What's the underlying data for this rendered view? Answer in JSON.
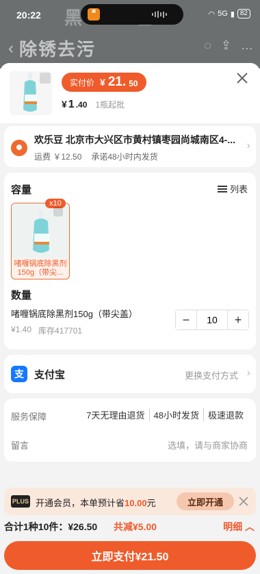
{
  "status_bar": {
    "time": "20:22",
    "battery": "82",
    "network": "5G"
  },
  "background": {
    "title": "黑",
    "title2": "喔",
    "nav_title": "除锈去污"
  },
  "product": {
    "price_tag": "实付价",
    "price_currency": "¥",
    "price_int": "21.",
    "price_dec": "50",
    "unit_currency": "¥",
    "unit_int": "1",
    "unit_dec": ".40",
    "moq": "1瓶起批"
  },
  "address": {
    "text": "欢乐豆 北京市大兴区市黄村镇枣园尚城南区4-...",
    "shipping": "运费 ￥12.50",
    "promise": "承诺48小时内发货"
  },
  "spec": {
    "capacity_title": "容量",
    "list_label": "列表",
    "sku_count": "x10",
    "sku_label": "啫喱锅底除黑剂150g（带尖...",
    "quantity_title": "数量",
    "item_name": "啫喱锅底除黑剂150g（带尖盖）",
    "item_price": "¥1.40",
    "stock": "库存417701",
    "quantity": "10"
  },
  "payment": {
    "method": "支付宝",
    "change": "更换支付方式"
  },
  "service": {
    "label": "服务保障",
    "tags": [
      "7天无理由退货",
      "48小时发货",
      "极速退款"
    ],
    "note_label": "留言",
    "note_placeholder": "选填，请与商家协商"
  },
  "membership": {
    "badge": "PLUS",
    "text_prefix": "开通会员，本单预计省",
    "saving": "10.00",
    "text_suffix": "元",
    "button": "立即开通"
  },
  "summary": {
    "total_prefix": "合计1种10件：",
    "total_amount": "¥26.50",
    "reduce_prefix": "共减",
    "reduce_amount": "¥5.00",
    "detail": "明细"
  },
  "checkout": {
    "label": "立即支付¥21.50"
  },
  "colors": {
    "accent": "#ef5b2b",
    "alipay": "#1677ff"
  }
}
